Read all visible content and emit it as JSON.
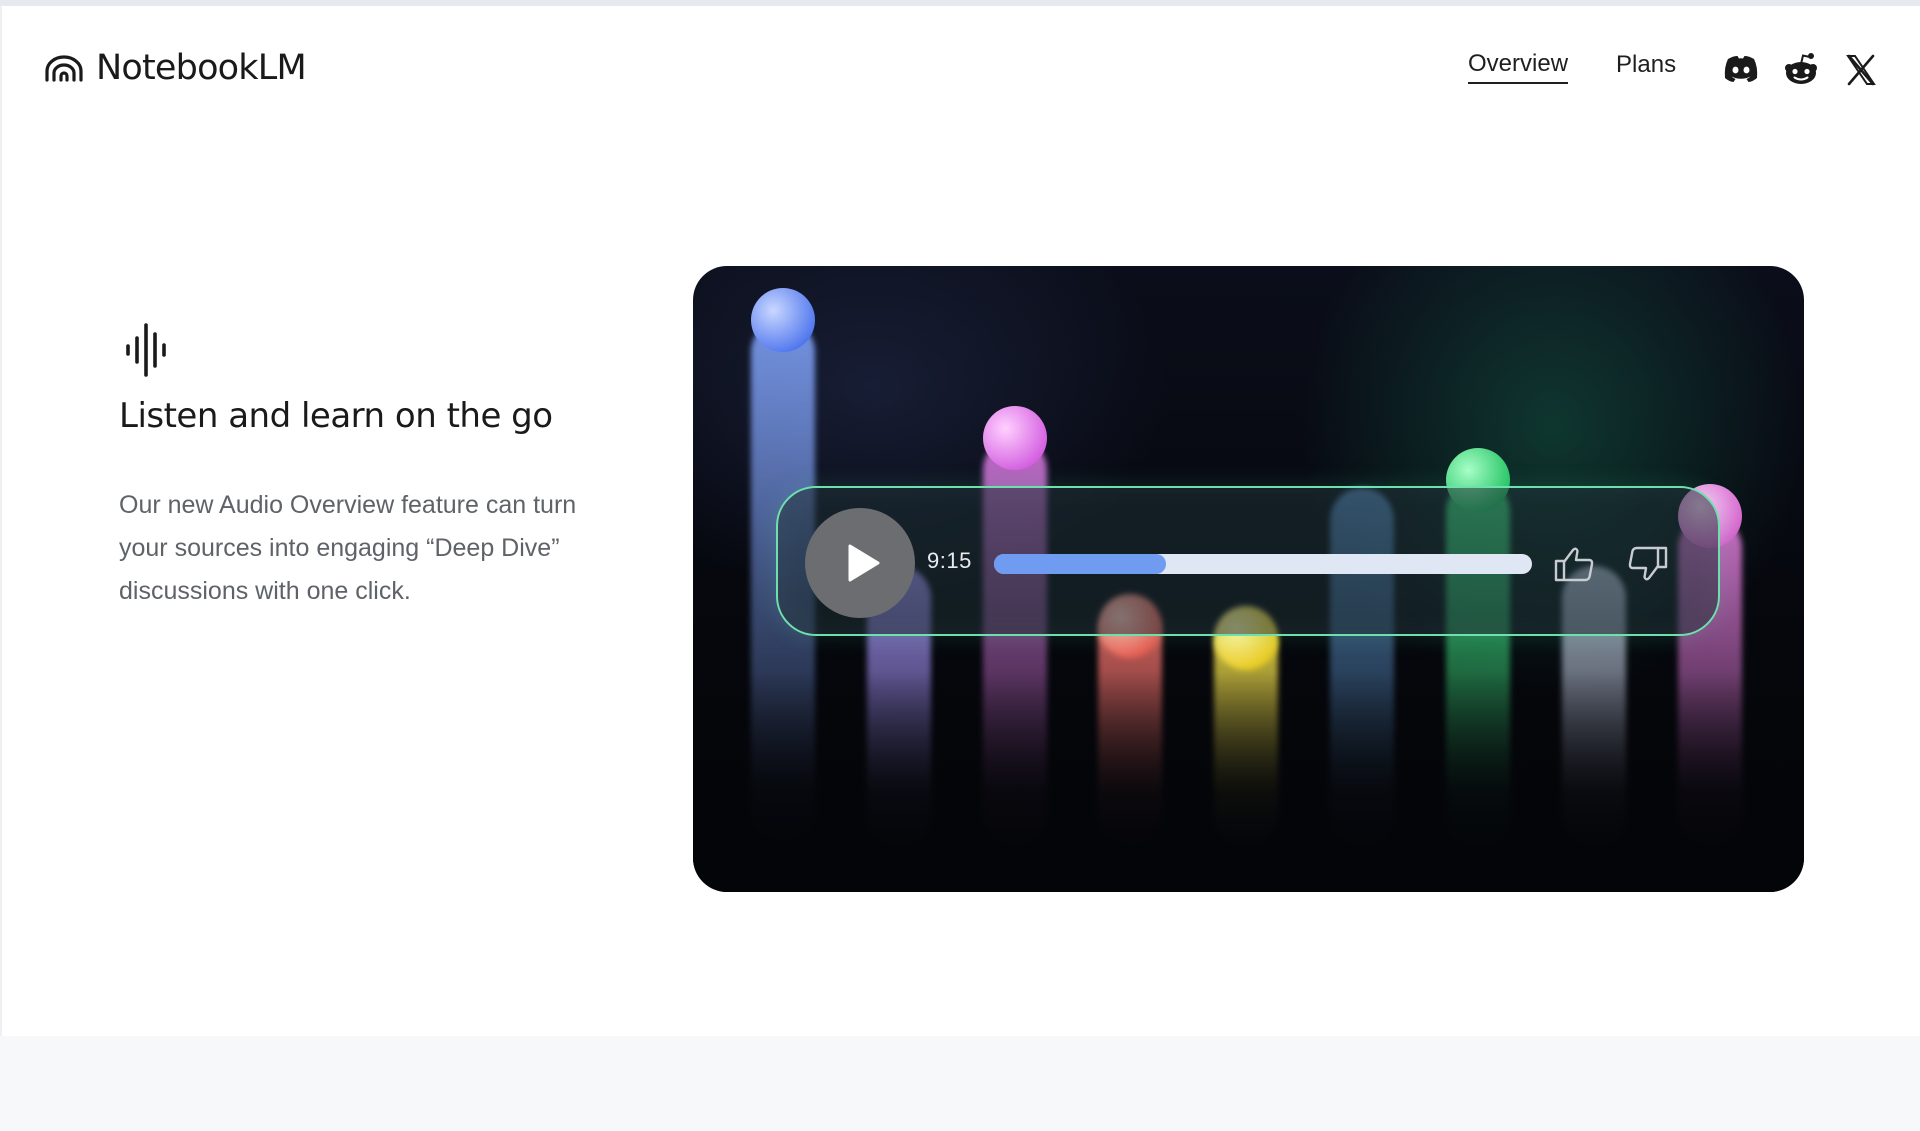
{
  "header": {
    "brand_name": "NotebookLM",
    "nav": [
      {
        "label": "Overview",
        "active": true
      },
      {
        "label": "Plans",
        "active": false
      }
    ],
    "social_icons": [
      "discord-icon",
      "reddit-icon",
      "x-icon"
    ]
  },
  "feature": {
    "icon": "audio-waveform-icon",
    "title": "Listen and learn on the go",
    "description": "Our new Audio Overview feature can turn your sources into engaging “Deep Dive” discussions with one click."
  },
  "player": {
    "time": "9:15",
    "progress": 0.32,
    "icons": [
      "play-icon",
      "thumb-up-icon",
      "thumb-down-icon"
    ]
  },
  "visualizer": {
    "colors": [
      "#7ea0f5",
      "#a08ef0",
      "#e07ce8",
      "#f0706a",
      "#f3e04a",
      "#6aa8e8",
      "#3ee080",
      "#c6d0e8",
      "#e87ee0"
    ]
  }
}
